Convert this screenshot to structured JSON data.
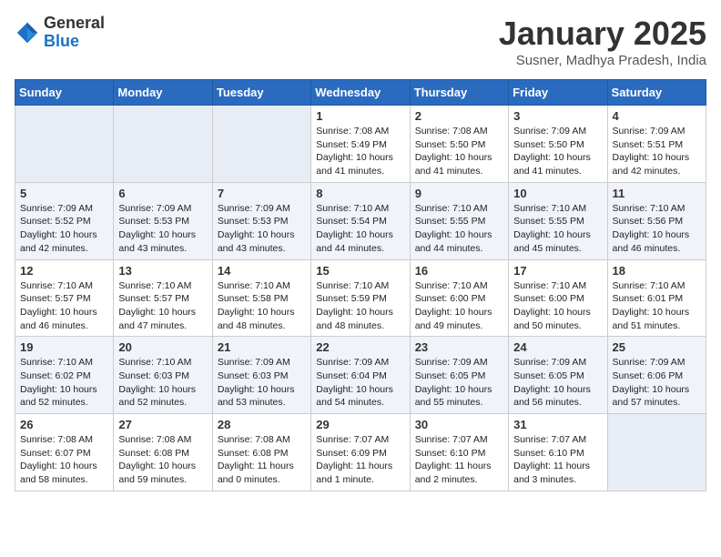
{
  "header": {
    "logo_general": "General",
    "logo_blue": "Blue",
    "month_title": "January 2025",
    "location": "Susner, Madhya Pradesh, India"
  },
  "days_of_week": [
    "Sunday",
    "Monday",
    "Tuesday",
    "Wednesday",
    "Thursday",
    "Friday",
    "Saturday"
  ],
  "weeks": [
    [
      null,
      null,
      null,
      {
        "day": "1",
        "sunrise": "7:08 AM",
        "sunset": "5:49 PM",
        "daylight": "10 hours and 41 minutes."
      },
      {
        "day": "2",
        "sunrise": "7:08 AM",
        "sunset": "5:50 PM",
        "daylight": "10 hours and 41 minutes."
      },
      {
        "day": "3",
        "sunrise": "7:09 AM",
        "sunset": "5:50 PM",
        "daylight": "10 hours and 41 minutes."
      },
      {
        "day": "4",
        "sunrise": "7:09 AM",
        "sunset": "5:51 PM",
        "daylight": "10 hours and 42 minutes."
      }
    ],
    [
      {
        "day": "5",
        "sunrise": "7:09 AM",
        "sunset": "5:52 PM",
        "daylight": "10 hours and 42 minutes."
      },
      {
        "day": "6",
        "sunrise": "7:09 AM",
        "sunset": "5:53 PM",
        "daylight": "10 hours and 43 minutes."
      },
      {
        "day": "7",
        "sunrise": "7:09 AM",
        "sunset": "5:53 PM",
        "daylight": "10 hours and 43 minutes."
      },
      {
        "day": "8",
        "sunrise": "7:10 AM",
        "sunset": "5:54 PM",
        "daylight": "10 hours and 44 minutes."
      },
      {
        "day": "9",
        "sunrise": "7:10 AM",
        "sunset": "5:55 PM",
        "daylight": "10 hours and 44 minutes."
      },
      {
        "day": "10",
        "sunrise": "7:10 AM",
        "sunset": "5:55 PM",
        "daylight": "10 hours and 45 minutes."
      },
      {
        "day": "11",
        "sunrise": "7:10 AM",
        "sunset": "5:56 PM",
        "daylight": "10 hours and 46 minutes."
      }
    ],
    [
      {
        "day": "12",
        "sunrise": "7:10 AM",
        "sunset": "5:57 PM",
        "daylight": "10 hours and 46 minutes."
      },
      {
        "day": "13",
        "sunrise": "7:10 AM",
        "sunset": "5:57 PM",
        "daylight": "10 hours and 47 minutes."
      },
      {
        "day": "14",
        "sunrise": "7:10 AM",
        "sunset": "5:58 PM",
        "daylight": "10 hours and 48 minutes."
      },
      {
        "day": "15",
        "sunrise": "7:10 AM",
        "sunset": "5:59 PM",
        "daylight": "10 hours and 48 minutes."
      },
      {
        "day": "16",
        "sunrise": "7:10 AM",
        "sunset": "6:00 PM",
        "daylight": "10 hours and 49 minutes."
      },
      {
        "day": "17",
        "sunrise": "7:10 AM",
        "sunset": "6:00 PM",
        "daylight": "10 hours and 50 minutes."
      },
      {
        "day": "18",
        "sunrise": "7:10 AM",
        "sunset": "6:01 PM",
        "daylight": "10 hours and 51 minutes."
      }
    ],
    [
      {
        "day": "19",
        "sunrise": "7:10 AM",
        "sunset": "6:02 PM",
        "daylight": "10 hours and 52 minutes."
      },
      {
        "day": "20",
        "sunrise": "7:10 AM",
        "sunset": "6:03 PM",
        "daylight": "10 hours and 52 minutes."
      },
      {
        "day": "21",
        "sunrise": "7:09 AM",
        "sunset": "6:03 PM",
        "daylight": "10 hours and 53 minutes."
      },
      {
        "day": "22",
        "sunrise": "7:09 AM",
        "sunset": "6:04 PM",
        "daylight": "10 hours and 54 minutes."
      },
      {
        "day": "23",
        "sunrise": "7:09 AM",
        "sunset": "6:05 PM",
        "daylight": "10 hours and 55 minutes."
      },
      {
        "day": "24",
        "sunrise": "7:09 AM",
        "sunset": "6:05 PM",
        "daylight": "10 hours and 56 minutes."
      },
      {
        "day": "25",
        "sunrise": "7:09 AM",
        "sunset": "6:06 PM",
        "daylight": "10 hours and 57 minutes."
      }
    ],
    [
      {
        "day": "26",
        "sunrise": "7:08 AM",
        "sunset": "6:07 PM",
        "daylight": "10 hours and 58 minutes."
      },
      {
        "day": "27",
        "sunrise": "7:08 AM",
        "sunset": "6:08 PM",
        "daylight": "10 hours and 59 minutes."
      },
      {
        "day": "28",
        "sunrise": "7:08 AM",
        "sunset": "6:08 PM",
        "daylight": "11 hours and 0 minutes."
      },
      {
        "day": "29",
        "sunrise": "7:07 AM",
        "sunset": "6:09 PM",
        "daylight": "11 hours and 1 minute."
      },
      {
        "day": "30",
        "sunrise": "7:07 AM",
        "sunset": "6:10 PM",
        "daylight": "11 hours and 2 minutes."
      },
      {
        "day": "31",
        "sunrise": "7:07 AM",
        "sunset": "6:10 PM",
        "daylight": "11 hours and 3 minutes."
      },
      null
    ]
  ]
}
